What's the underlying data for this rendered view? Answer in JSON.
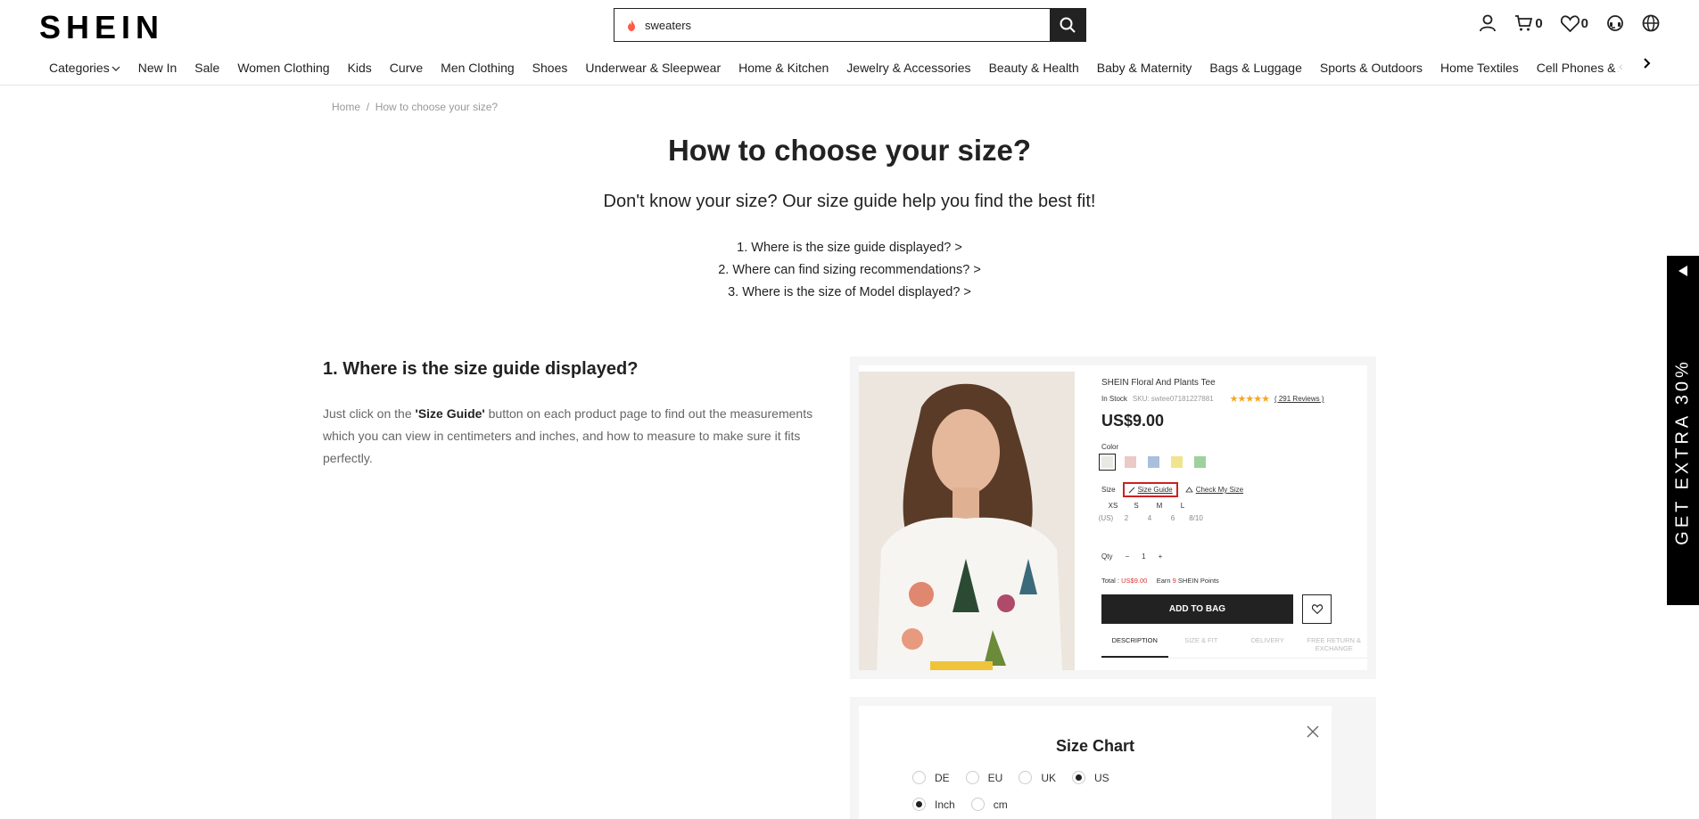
{
  "header": {
    "logo": "SHEIN",
    "search_value": "sweaters",
    "cart_count": "0",
    "wishlist_count": "0"
  },
  "nav": {
    "items": [
      "Categories",
      "New In",
      "Sale",
      "Women Clothing",
      "Kids",
      "Curve",
      "Men Clothing",
      "Shoes",
      "Underwear & Sleepwear",
      "Home & Kitchen",
      "Jewelry & Accessories",
      "Beauty & Health",
      "Baby & Maternity",
      "Bags & Luggage",
      "Sports & Outdoors",
      "Home Textiles",
      "Cell Phones & Accessories"
    ]
  },
  "breadcrumb": {
    "home": "Home",
    "separator": "/",
    "current": "How to choose your size?"
  },
  "page": {
    "title": "How to choose your size?",
    "subtitle": "Don't know your size? Our size guide help you find the best fit!",
    "toc": [
      "1. Where is the size guide displayed? >",
      "2. Where can find sizing recommendations? >",
      "3. Where is the size of Model displayed? >"
    ]
  },
  "section1": {
    "title": "1. Where is the size guide displayed?",
    "body_pre": "Just click on the ",
    "body_bold": "'Size Guide'",
    "body_post": " button on each product page to find out the measurements which you can view in centimeters and inches, and how to measure to make sure it fits perfectly."
  },
  "product": {
    "name": "SHEIN Floral And Plants Tee",
    "stock": "In Stock",
    "sku": "SKU: swtee07181227881",
    "stars": "★★★★★",
    "reviews": "( 291 Reviews )",
    "price": "US$9.00",
    "color_label": "Color",
    "swatch_colors": [
      "#e9e9e4",
      "#ecc9c4",
      "#a9bfdc",
      "#f0e48e",
      "#9ed19b"
    ],
    "size_label": "Size",
    "size_guide": "Size Guide",
    "check_size": "Check My Size",
    "sizes": [
      "XS",
      "S",
      "M",
      "L"
    ],
    "us_label": "(US)",
    "us_sizes": [
      "2",
      "4",
      "6",
      "8/10"
    ],
    "qty_label": "Qty",
    "qty_minus": "−",
    "qty_value": "1",
    "qty_plus": "+",
    "total_label": "Total :",
    "total_value": "US$9.00",
    "earn_label": "Earn",
    "earn_value": "9",
    "points_label": "SHEIN Points",
    "add_to_bag": "ADD TO BAG",
    "tabs": [
      "DESCRIPTION",
      "SIZE & FIT",
      "DELIVERY",
      "FREE RETURN & EXCHANGE"
    ]
  },
  "size_chart": {
    "title": "Size Chart",
    "regions": [
      "DE",
      "EU",
      "UK",
      "US"
    ],
    "selected_region": "US",
    "units": [
      "Inch",
      "cm"
    ],
    "selected_unit": "Inch"
  },
  "promo": {
    "text": "GET EXTRA 30%"
  },
  "colors": {
    "primary": "#222222",
    "accent_red": "#cc2222"
  }
}
